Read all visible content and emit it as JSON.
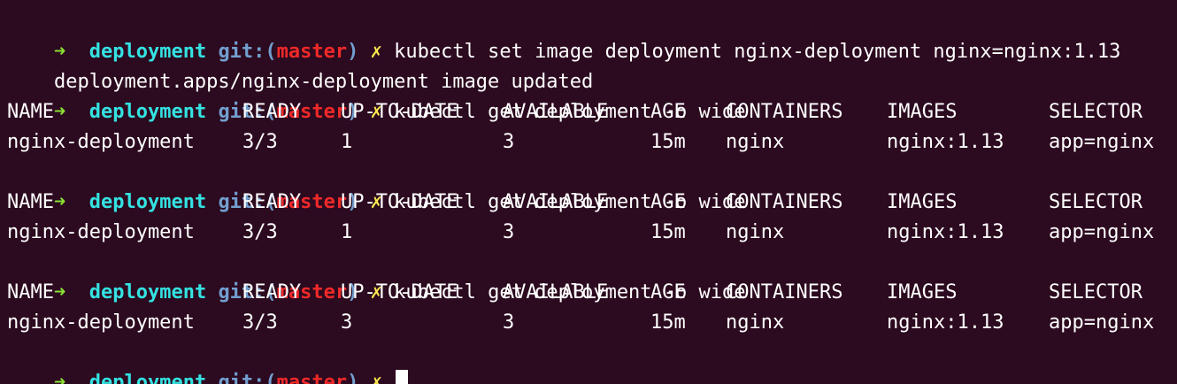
{
  "prompt": {
    "arrow": "➜",
    "dir": "deployment",
    "git_open": "git:(",
    "branch": "master",
    "git_close": ")",
    "dirty": "✗"
  },
  "lines": {
    "cmd1": "kubectl set image deployment nginx-deployment nginx=nginx:1.13",
    "out1": "deployment.apps/nginx-deployment image updated",
    "cmd2": "kubectl get deployment -o wide",
    "cmd3": "kubectl get deployment -o wide",
    "cmd4": "kubectl get deployment -o wide"
  },
  "table": {
    "headers": [
      "NAME",
      "READY",
      "UP-TO-DATE",
      "AVAILABLE",
      "AGE",
      "CONTAINERS",
      "IMAGES",
      "SELECTOR"
    ],
    "rows": [
      [
        "nginx-deployment",
        "3/3",
        "1",
        "3",
        "15m",
        "nginx",
        "nginx:1.13",
        "app=nginx"
      ],
      [
        "nginx-deployment",
        "3/3",
        "1",
        "3",
        "15m",
        "nginx",
        "nginx:1.13",
        "app=nginx"
      ],
      [
        "nginx-deployment",
        "3/3",
        "3",
        "3",
        "15m",
        "nginx",
        "nginx:1.13",
        "app=nginx"
      ]
    ]
  },
  "colors": {
    "background": "#2c0a1f",
    "arrow": "#8ae234",
    "dir": "#34e2e2",
    "git": "#729fcf",
    "branch": "#ef2929",
    "dirty": "#fce94f"
  }
}
